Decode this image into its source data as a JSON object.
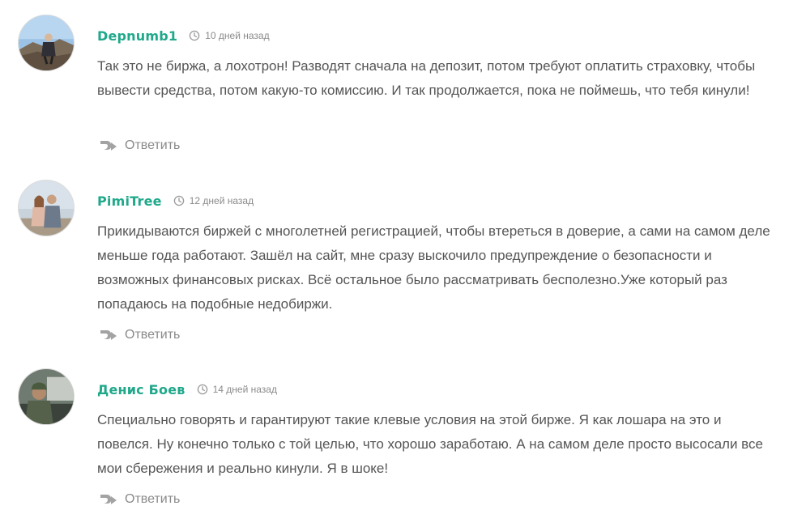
{
  "comments": [
    {
      "author": "Depnumb1",
      "time": "10 дней назад",
      "text": "Так это не биржа, а лохотрон! Разводят сначала на депозит, потом требуют оплатить страховку, чтобы вывести средства, потом какую-то комиссию. И так продолжается, пока не поймешь, что тебя кинули!",
      "reply": "Ответить"
    },
    {
      "author": "PimiTree",
      "time": "12 дней назад",
      "text": "Прикидываются биржей с многолетней регистрацией, чтобы втереться в доверие, а сами на самом деле меньше года работают. Зашёл на сайт, мне сразу выскочило предупреждение о безопасности и возможных финансовых рисках. Всё остальное было рассматривать бесполезно.Уже который раз попадаюсь на подобные недобиржи.",
      "reply": "Ответить"
    },
    {
      "author": "Денис Боев",
      "time": "14 дней назад",
      "text": "Специально говорять и гарантируют такие клевые условия на этой бирже. Я как лошара на это и повелся. Ну конечно только с той целью, что хорошо заработаю. А на самом деле просто высосали все мои сбережения и реально кинули. Я в шоке!",
      "reply": "Ответить"
    }
  ],
  "colors": {
    "author": "#1fa88a",
    "text": "#555555",
    "muted": "#8a8a8a"
  },
  "icons": {
    "time": "clock-icon",
    "reply": "reply-arrow-icon"
  }
}
